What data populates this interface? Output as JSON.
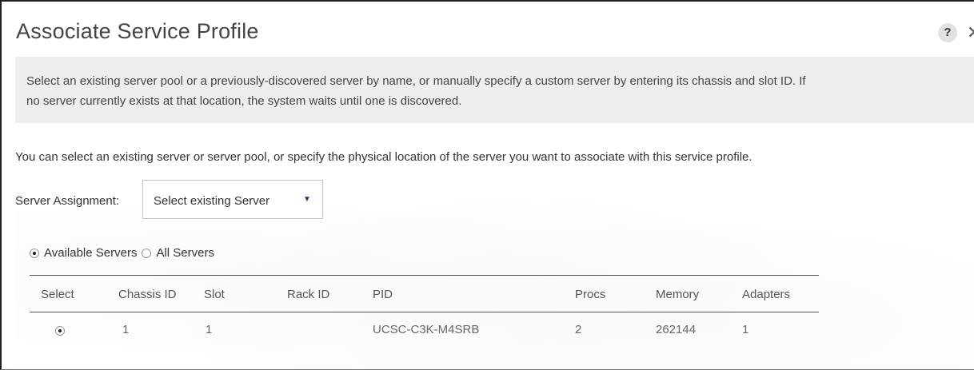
{
  "dialog": {
    "title": "Associate Service Profile",
    "help_glyph": "?",
    "close_glyph": "✕"
  },
  "info": {
    "line1": "Select an existing server pool or a previously-discovered server by name, or manually specify a custom server by entering its chassis and slot ID. If",
    "line2": "no server currently exists at that location, the system waits until one is discovered."
  },
  "description": "You can select an existing server or server pool, or specify the physical location of the server you want to associate with this service profile.",
  "server_assignment": {
    "label": "Server Assignment:",
    "selected": "Select existing Server",
    "caret": "▼"
  },
  "filter": {
    "available_label": "Available Servers",
    "all_label": "All Servers",
    "selected": "available"
  },
  "table": {
    "headers": {
      "select": "Select",
      "chassis_id": "Chassis ID",
      "slot": "Slot",
      "rack_id": "Rack ID",
      "pid": "PID",
      "procs": "Procs",
      "memory": "Memory",
      "adapters": "Adapters"
    },
    "rows": [
      {
        "selected": true,
        "chassis_id": "1",
        "slot": "1",
        "rack_id": "",
        "pid": "UCSC-C3K-M4SRB",
        "procs": "2",
        "memory": "262144",
        "adapters": "1"
      }
    ]
  },
  "colors": {
    "info_background": "#eeeeee",
    "title_text": "#444444",
    "caret": "#2a3c6e"
  }
}
